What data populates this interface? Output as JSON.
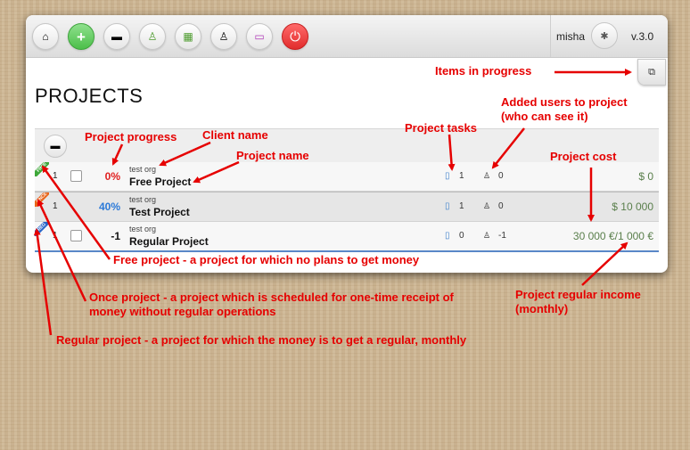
{
  "app": {
    "username": "misha",
    "version": "v.3.0",
    "page_title": "PROJECTS"
  },
  "toolbar": {
    "buttons": [
      {
        "icon": "home-icon",
        "glyph": "⌂"
      },
      {
        "icon": "add-icon",
        "glyph": "+"
      },
      {
        "icon": "folder-icon",
        "glyph": "▬"
      },
      {
        "icon": "user-icon",
        "glyph": "♙"
      },
      {
        "icon": "grid-icon",
        "glyph": "▦"
      },
      {
        "icon": "user-icon",
        "glyph": "♙"
      },
      {
        "icon": "ticket-icon",
        "glyph": "▭"
      },
      {
        "icon": "power-icon",
        "glyph": "⏻"
      }
    ],
    "settings_glyph": "✱",
    "in_progress_glyph": "⧉"
  },
  "projects": [
    {
      "ribbon": "FREE",
      "ribbon_color": "#3ea83a",
      "num": "1",
      "progress": "0%",
      "progress_color": "#e02020",
      "client": "test org",
      "name": "Free Project",
      "tasks": "1",
      "users": "0",
      "cost": "$ 0"
    },
    {
      "ribbon": "ONCE",
      "ribbon_color": "#e8651a",
      "num": "1",
      "progress": "40%",
      "progress_color": "#2c7ad8",
      "client": "test org",
      "name": "Test Project",
      "tasks": "1",
      "users": "0",
      "cost": "$ 10 000"
    },
    {
      "ribbon": "REG",
      "ribbon_color": "#2a66c8",
      "num": "1",
      "progress": "-1",
      "progress_color": "#111111",
      "client": "test org",
      "name": "Regular Project",
      "tasks": "0",
      "users": "-1",
      "cost": "30 000 €/1 000 €"
    }
  ],
  "annotations": {
    "items_in_progress": "Items in progress",
    "added_users": "Added users to project (who can see it)",
    "project_progress": "Project progress",
    "client_name": "Client name",
    "project_tasks": "Project tasks",
    "project_name": "Project name",
    "project_cost": "Project cost",
    "free_project": "Free project - a project for which no plans to get money",
    "once_project": "Once project - a project which is scheduled for one-time receipt of money without regular operations",
    "regular_project": "Regular project - a project for which the money is to get a regular, monthly",
    "regular_income": "Project regular income (monthly)"
  },
  "colors": {
    "annotation": "#e60000",
    "cost_green": "#5a7f4c"
  }
}
